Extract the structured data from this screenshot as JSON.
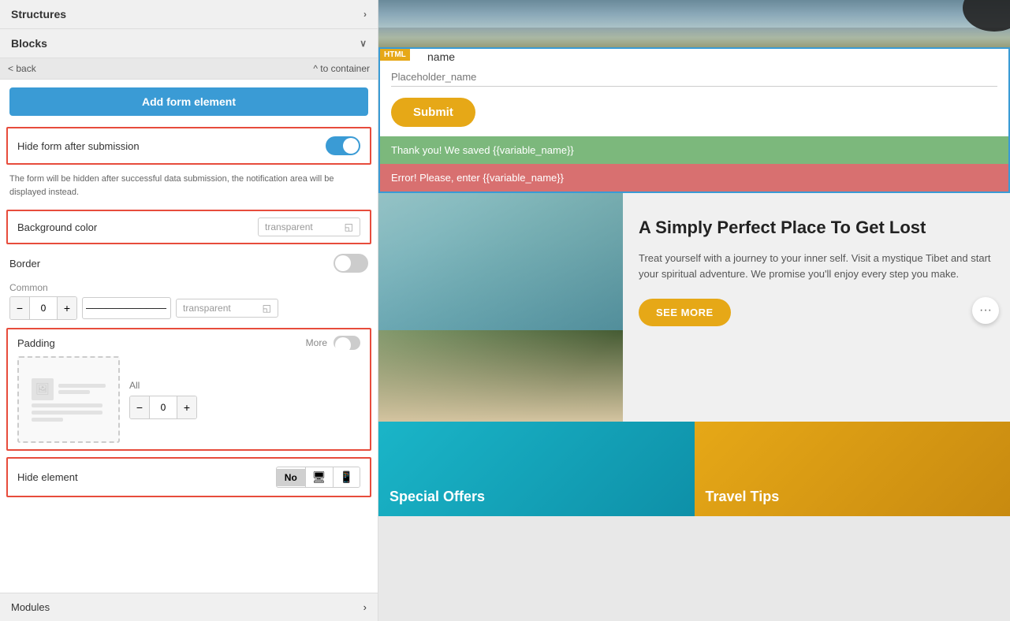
{
  "leftPanel": {
    "structures_label": "Structures",
    "blocks_label": "Blocks",
    "back_label": "< back",
    "to_container_label": "^ to container",
    "add_form_element_label": "Add form element",
    "hide_form_label": "Hide form after submission",
    "hide_form_description": "The form will be hidden after successful data submission, the notification area will be displayed instead.",
    "background_color_label": "Background color",
    "background_color_value": "transparent",
    "border_label": "Border",
    "common_label": "Common",
    "common_stepper_value": "0",
    "common_color_value": "transparent",
    "padding_label": "Padding",
    "more_label": "More",
    "all_label": "All",
    "padding_stepper_value": "0",
    "hide_element_label": "Hide element",
    "hide_no_label": "No",
    "modules_label": "Modules"
  },
  "rightPanel": {
    "html_badge": "HTML",
    "form_name_label": "name",
    "form_placeholder": "Placeholder_name",
    "submit_label": "Submit",
    "success_message": "Thank you! We saved {{variable_name}}",
    "error_message": "Error! Please, enter {{variable_name}}",
    "travel_title": "A Simply Perfect Place To Get Lost",
    "travel_desc": "Treat yourself with a journey to your inner self. Visit a mystique Tibet and start your spiritual adventure. We promise you'll enjoy every step you make.",
    "see_more_label": "SEE MORE",
    "special_offers_label": "Special Offers",
    "travel_tips_label": "Travel Tips",
    "more_icon": "···"
  }
}
